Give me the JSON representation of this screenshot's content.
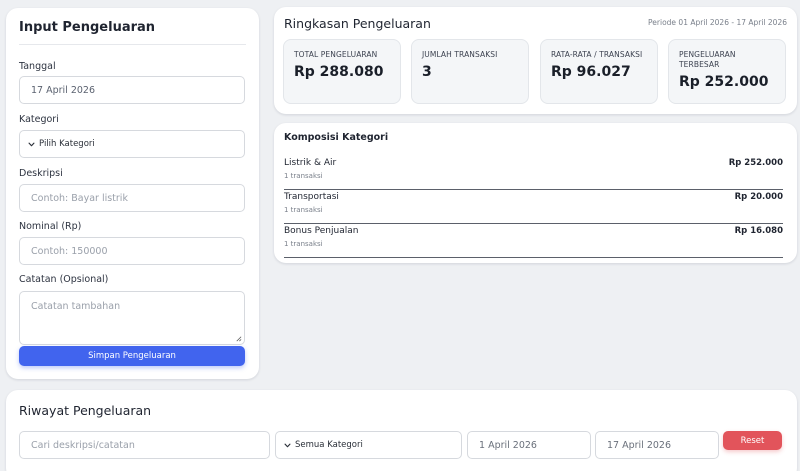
{
  "input": {
    "title": "Input Pengeluaran",
    "date_label": "Tanggal",
    "date_value": "17 April 2026",
    "category_label": "Kategori",
    "category_value": "Pilih Kategori",
    "description_label": "Deskripsi",
    "description_placeholder": "Contoh: Bayar listrik",
    "amount_label": "Nominal (Rp)",
    "amount_placeholder": "Contoh: 150000",
    "notes_label": "Catatan (Opsional)",
    "notes_placeholder": "Catatan tambahan",
    "save_label": "Simpan Pengeluaran"
  },
  "summary": {
    "title": "Ringkasan Pengeluaran",
    "period": "Periode 01 April 2026 - 17 April 2026",
    "stats": [
      {
        "label": "TOTAL PENGELUARAN",
        "value": "Rp 288.080"
      },
      {
        "label": "JUMLAH TRANSAKSI",
        "value": "3"
      },
      {
        "label": "RATA-RATA / TRANSAKSI",
        "value": "Rp 96.027"
      },
      {
        "label": "PENGELUARAN TERBESAR",
        "value": "Rp 252.000"
      }
    ]
  },
  "categories": {
    "title": "Komposisi Kategori",
    "items": [
      {
        "name": "Listrik & Air",
        "count": "1 transaksi",
        "amount": "Rp 252.000"
      },
      {
        "name": "Transportasi",
        "count": "1 transaksi",
        "amount": "Rp 20.000"
      },
      {
        "name": "Bonus Penjualan",
        "count": "1 transaksi",
        "amount": "Rp 16.080"
      }
    ]
  },
  "history": {
    "title": "Riwayat Pengeluaran",
    "search_placeholder": "Cari deskripsi/catatan",
    "category_filter": "Semua Kategori",
    "date_from": "1 April 2026",
    "date_to": "17 April 2026",
    "reset_label": "Reset"
  },
  "colors": {
    "primary": "#4164ee",
    "danger": "#e2545b",
    "background": "#eef0f3"
  }
}
